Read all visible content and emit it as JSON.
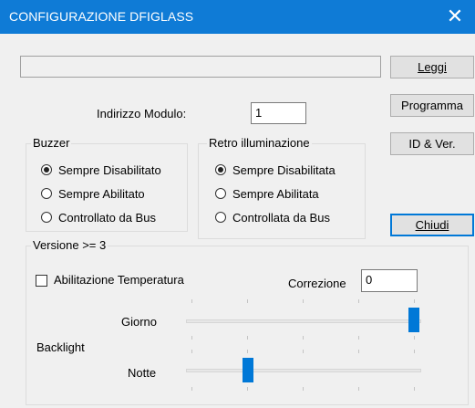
{
  "window": {
    "title": "CONFIGURAZIONE DFIGLASS",
    "close_glyph": "✕"
  },
  "buttons": {
    "leggi": "Leggi",
    "programma": "Programma",
    "id_ver": "ID & Ver.",
    "chiudi": "Chiudi"
  },
  "indirizzo": {
    "label": "Indirizzo Modulo:",
    "value": "1"
  },
  "buzzer": {
    "title": "Buzzer",
    "options": [
      "Sempre Disabilitato",
      "Sempre Abilitato",
      "Controllato da Bus"
    ],
    "selected": 0
  },
  "retro": {
    "title": "Retro illuminazione",
    "options": [
      "Sempre Disabilitata",
      "Sempre Abilitata",
      "Controllata da Bus"
    ],
    "selected": 0
  },
  "versione": {
    "title": "Versione >= 3",
    "temp_label": "Abilitazione Temperatura",
    "temp_checked": false,
    "correzione_label": "Correzione",
    "correzione_value": "0",
    "backlight_label": "Backlight",
    "giorno_label": "Giorno",
    "notte_label": "Notte",
    "giorno_level": 1.0,
    "notte_level": 0.25
  },
  "colors": {
    "titlebar": "#0f7bd6",
    "accent": "#0078d7",
    "background": "#f0f0f0"
  }
}
